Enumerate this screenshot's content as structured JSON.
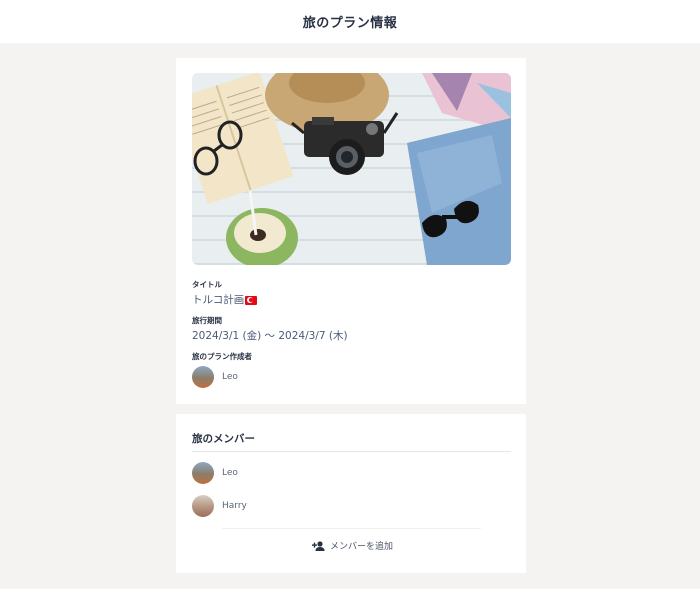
{
  "header": {
    "title": "旅のプラン情報"
  },
  "plan": {
    "title_label": "タイトル",
    "title_value": "トルコ計画",
    "period_label": "旅行期間",
    "period_value": "2024/3/1 (金) 〜 2024/3/7 (木)",
    "creator_label": "旅のプラン作成者",
    "creator_name": "Leo"
  },
  "members": {
    "title": "旅のメンバー",
    "list": [
      {
        "name": "Leo"
      },
      {
        "name": "Harry"
      }
    ],
    "add_label": "メンバーを追加"
  },
  "icons": {
    "flag": "turkey-flag-icon",
    "add_member": "person-add-icon"
  },
  "colors": {
    "background": "#f4f3f1",
    "card": "#ffffff",
    "heading": "#2a3144",
    "value_text": "#4a5a78"
  }
}
